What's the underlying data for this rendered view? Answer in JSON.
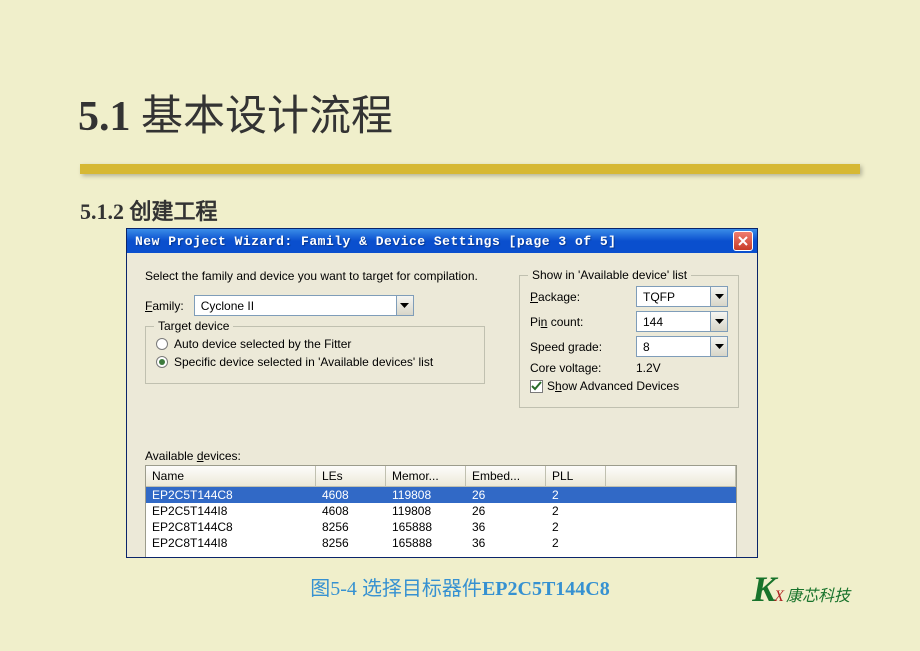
{
  "slide": {
    "heading_num": "5.1",
    "heading_text": "基本设计流程",
    "subheading_num": "5.1.2",
    "subheading_text": "创建工程",
    "caption_prefix": "图",
    "caption_num": "5-4",
    "caption_text": " 选择目标器件",
    "caption_dev": "EP2C5T144C8",
    "logo_k": "K",
    "logo_x": "X",
    "logo_text": "康芯科技"
  },
  "dialog": {
    "title": "New Project Wizard: Family & Device Settings [page 3 of 5]",
    "close_aria": "Close",
    "instruction": "Select the family and device you want to target for compilation.",
    "family_label_pre": "F",
    "family_label_post": "amily:",
    "family_value": "Cyclone II",
    "target_device_legend": "Target device",
    "radio_auto_label": "Auto device selected by the Fitter",
    "radio_specific_label": "Specific device selected in 'Available devices' list",
    "radio_selected": "specific",
    "right_legend": "Show in 'Available device' list",
    "package_label_pre": "P",
    "package_label_post": "ackage:",
    "package_value": "TQFP",
    "pin_label_pre": "Pi",
    "pin_underline": "n",
    "pin_label_post": " count:",
    "pin_value": "144",
    "speed_label": "Speed grade:",
    "speed_value": "8",
    "core_label": "Core voltage:",
    "core_value": "1.2V",
    "show_adv_pre": "S",
    "show_adv_underline": "h",
    "show_adv_post": "ow Advanced Devices",
    "show_adv_checked": true,
    "avail_label_pre": "Available ",
    "avail_underline": "d",
    "avail_label_post": "evices:",
    "grid": {
      "headers": [
        "Name",
        "LEs",
        "Memor...",
        "Embed...",
        "PLL",
        ""
      ],
      "rows": [
        {
          "cells": [
            "EP2C5T144C8",
            "4608",
            "119808",
            "26",
            "2"
          ],
          "selected": true
        },
        {
          "cells": [
            "EP2C5T144I8",
            "4608",
            "119808",
            "26",
            "2"
          ],
          "selected": false
        },
        {
          "cells": [
            "EP2C8T144C8",
            "8256",
            "165888",
            "36",
            "2"
          ],
          "selected": false
        },
        {
          "cells": [
            "EP2C8T144I8",
            "8256",
            "165888",
            "36",
            "2"
          ],
          "selected": false
        }
      ]
    }
  }
}
